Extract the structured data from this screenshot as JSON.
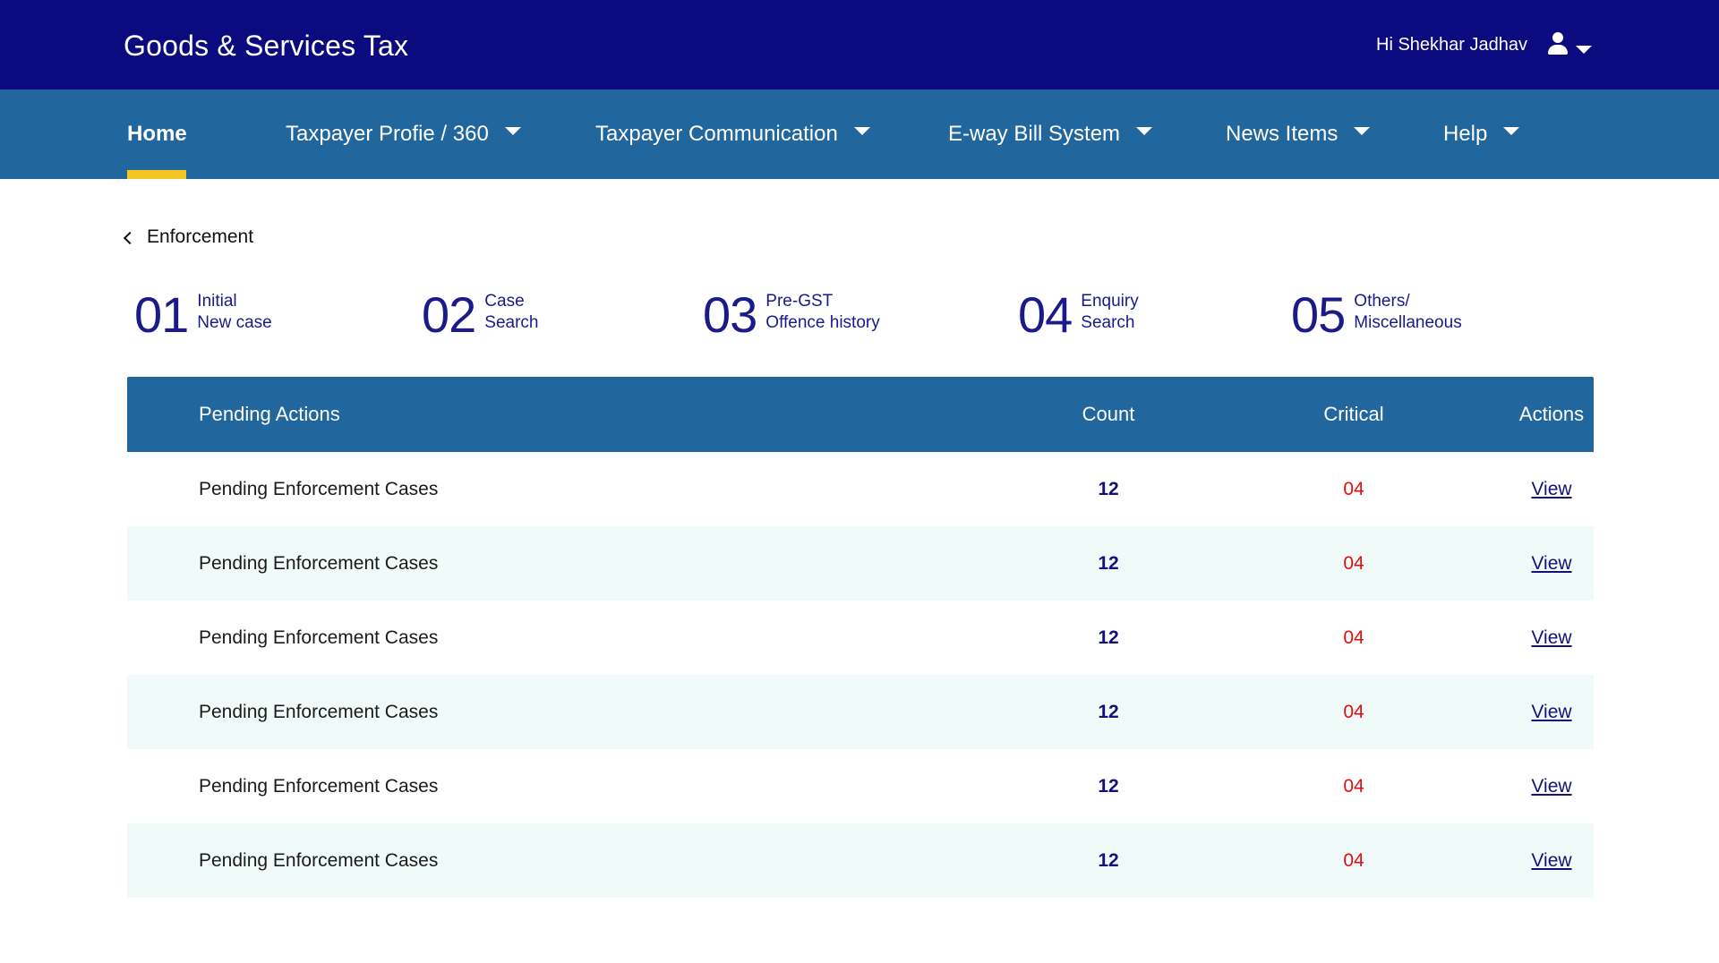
{
  "header": {
    "brand": "Goods & Services Tax",
    "greeting": "Hi Shekhar Jadhav"
  },
  "nav": {
    "home": "Home",
    "taxpayer_profile": "Taxpayer Profie / 360",
    "taxpayer_communication": "Taxpayer Communication",
    "eway_bill": "E-way Bill System",
    "news_items": "News Items",
    "help": "Help"
  },
  "breadcrumb": {
    "label": "Enforcement"
  },
  "steps": [
    {
      "num": "01",
      "line1": "Initial",
      "line2": "New case"
    },
    {
      "num": "02",
      "line1": "Case",
      "line2": "Search"
    },
    {
      "num": "03",
      "line1": "Pre-GST",
      "line2": "Offence history"
    },
    {
      "num": "04",
      "line1": "Enquiry",
      "line2": "Search"
    },
    {
      "num": "05",
      "line1": "Others/",
      "line2": "Miscellaneous"
    }
  ],
  "table": {
    "headers": {
      "name": "Pending Actions",
      "count": "Count",
      "critical": "Critical",
      "actions": "Actions"
    },
    "rows": [
      {
        "name": "Pending Enforcement Cases",
        "count": "12",
        "critical": "04",
        "action": "View"
      },
      {
        "name": "Pending Enforcement Cases",
        "count": "12",
        "critical": "04",
        "action": "View"
      },
      {
        "name": "Pending Enforcement Cases",
        "count": "12",
        "critical": "04",
        "action": "View"
      },
      {
        "name": "Pending Enforcement Cases",
        "count": "12",
        "critical": "04",
        "action": "View"
      },
      {
        "name": "Pending Enforcement Cases",
        "count": "12",
        "critical": "04",
        "action": "View"
      },
      {
        "name": "Pending Enforcement Cases",
        "count": "12",
        "critical": "04",
        "action": "View"
      }
    ]
  },
  "colors": {
    "topbar": "#0b0a7e",
    "navbar": "#22669e",
    "accent": "#f5c623",
    "critical": "#e01010",
    "alt_row": "#f0faf8"
  }
}
